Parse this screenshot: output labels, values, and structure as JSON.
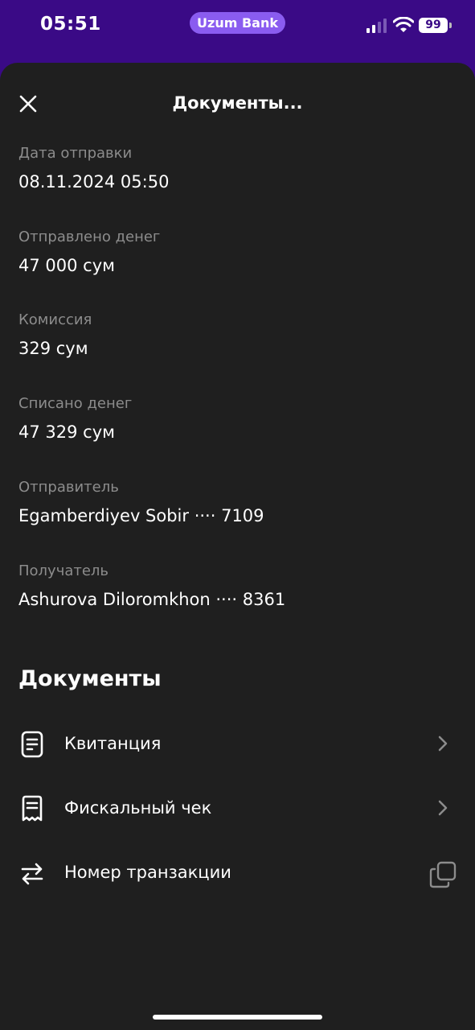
{
  "status_bar": {
    "time": "05:51",
    "app_name": "Uzum Bank",
    "battery": "99"
  },
  "header": {
    "title": "Документы..."
  },
  "fields": [
    {
      "label": "Дата отправки",
      "value": "08.11.2024 05:50"
    },
    {
      "label": "Отправлено денег",
      "value": "47 000 сум"
    },
    {
      "label": "Комиссия",
      "value": "329 сум"
    },
    {
      "label": "Списано денег",
      "value": "47 329 сум"
    },
    {
      "label": "Отправитель",
      "value": "Egamberdiyev Sobir ···· 7109"
    },
    {
      "label": "Получатель",
      "value": "Ashurova Diloromkhon ···· 8361"
    }
  ],
  "documents": {
    "heading": "Документы",
    "items": [
      {
        "label": "Квитанция",
        "icon": "document-icon",
        "action": "chevron-right-icon"
      },
      {
        "label": "Фискальный чек",
        "icon": "receipt-icon",
        "action": "chevron-right-icon"
      },
      {
        "label": "Номер транзакции",
        "icon": "transfer-arrows-icon",
        "action": "copy-icon"
      }
    ]
  },
  "colors": {
    "status_bar_bg": "#3a0a86",
    "sheet_bg": "#1f1f1f",
    "pill_bg": "#8a5cf0",
    "label_gray": "#8c8c8c",
    "text": "#ffffff"
  }
}
